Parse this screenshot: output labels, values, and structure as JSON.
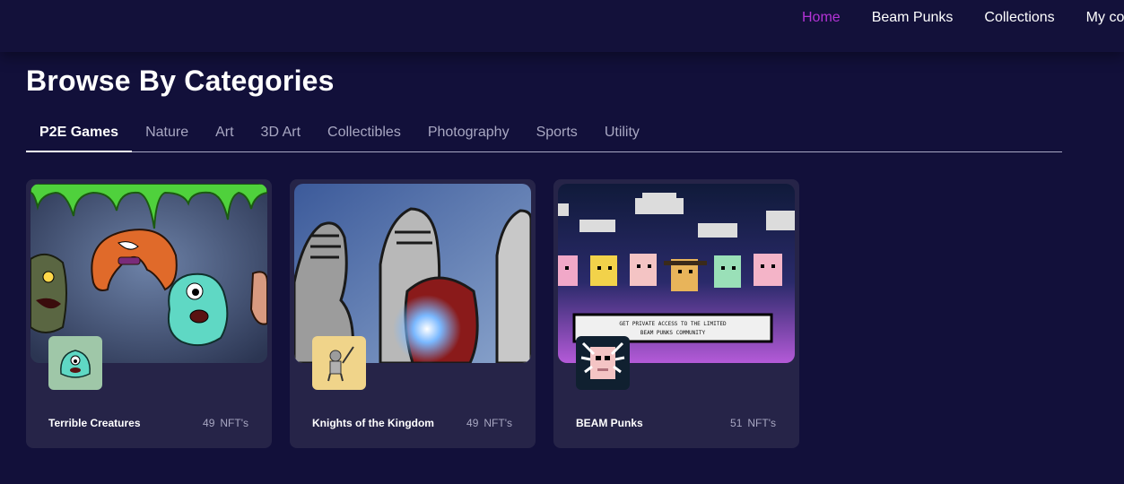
{
  "nav": {
    "links": [
      {
        "label": "Home",
        "active": true
      },
      {
        "label": "Beam Punks",
        "active": false
      },
      {
        "label": "Collections",
        "active": false
      },
      {
        "label": "My co",
        "active": false
      }
    ]
  },
  "page": {
    "title": "Browse By Categories"
  },
  "tabs": [
    {
      "label": "P2E Games",
      "active": true
    },
    {
      "label": "Nature"
    },
    {
      "label": "Art"
    },
    {
      "label": "3D Art"
    },
    {
      "label": "Collectibles"
    },
    {
      "label": "Photography"
    },
    {
      "label": "Sports"
    },
    {
      "label": "Utility"
    }
  ],
  "collections": [
    {
      "name": "Terrible Creatures",
      "count": "49",
      "unit": "NFT's"
    },
    {
      "name": "Knights of the Kingdom",
      "count": "49",
      "unit": "NFT's"
    },
    {
      "name": "BEAM Punks",
      "count": "51",
      "unit": "NFT's",
      "banner_text": "GET PRIVATE ACCESS TO THE LIMITED BEAM PUNKS COMMUNITY"
    }
  ],
  "colors": {
    "accent": "#b433d6",
    "background": "#12103a",
    "card": "#262448"
  }
}
